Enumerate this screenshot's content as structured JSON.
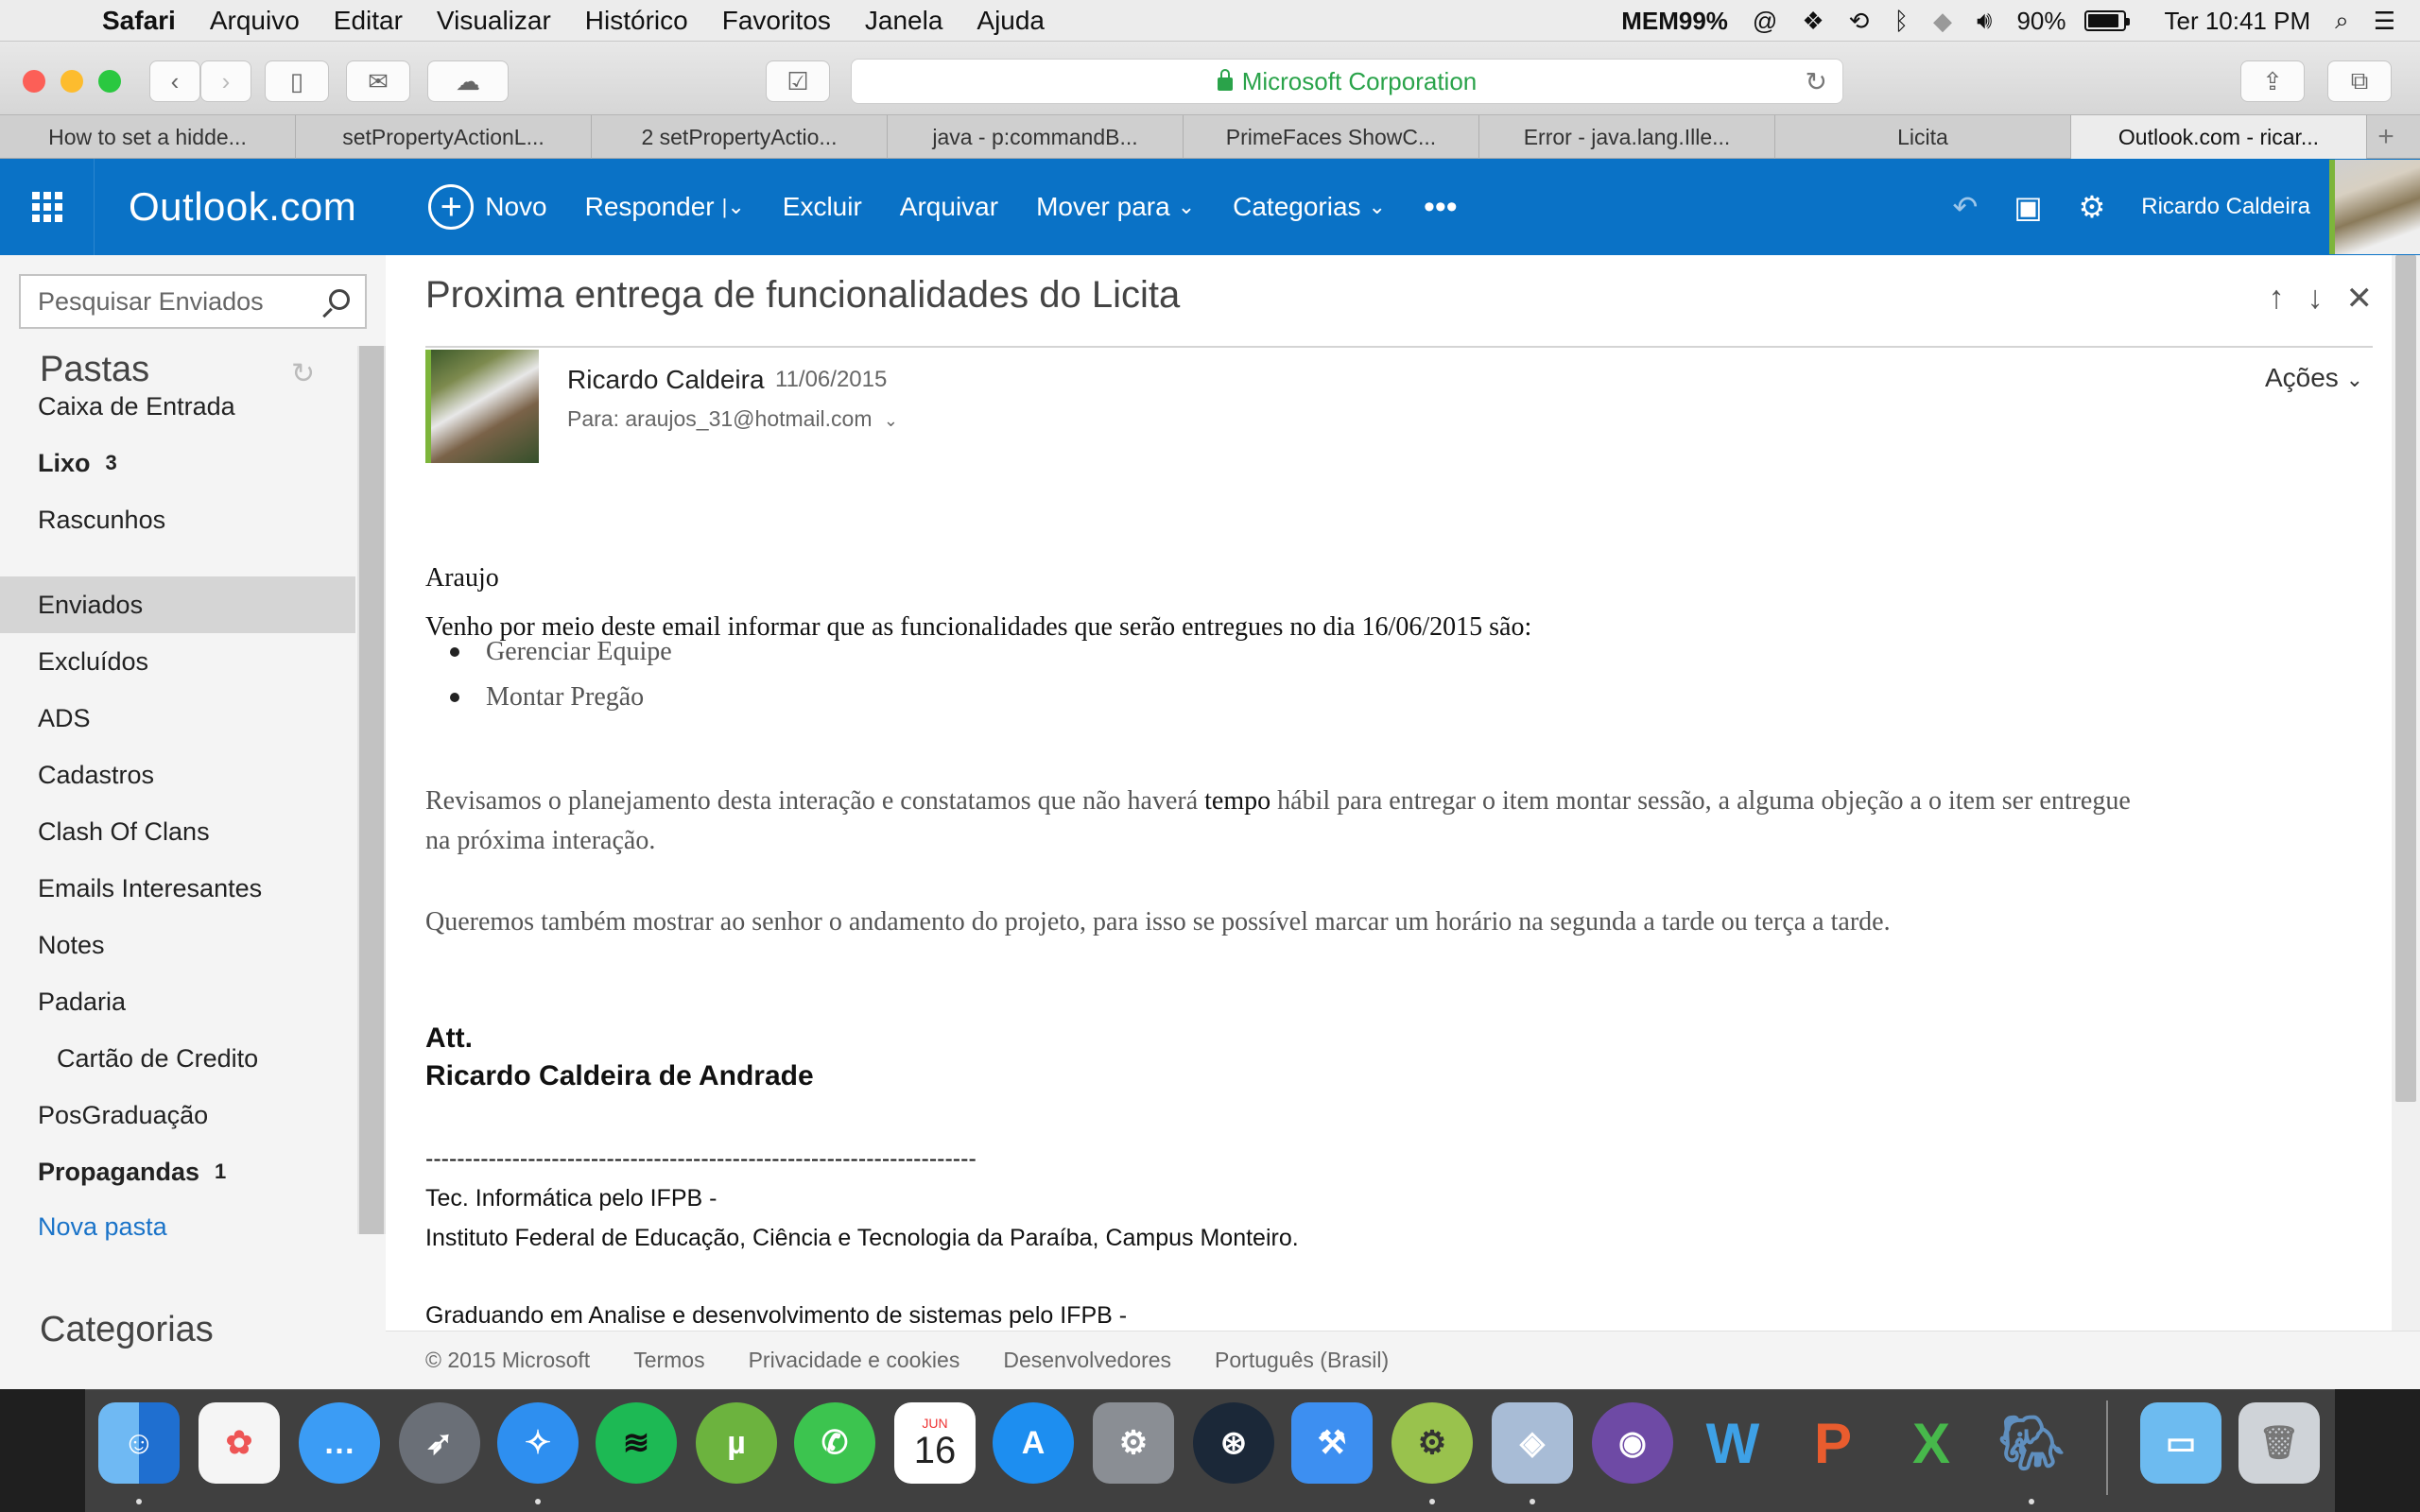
{
  "menubar": {
    "app": "Safari",
    "items": [
      "Arquivo",
      "Editar",
      "Visualizar",
      "Histórico",
      "Favoritos",
      "Janela",
      "Ajuda"
    ],
    "mem_label": "MEM",
    "mem_value": "99%",
    "battery": "90%",
    "battery_level": 0.9,
    "clock": "Ter 10:41 PM"
  },
  "browser": {
    "url_site": "Microsoft Corporation",
    "tabs": [
      {
        "label": "How to set a hidde..."
      },
      {
        "label": "setPropertyActionL..."
      },
      {
        "label": "2 setPropertyActio..."
      },
      {
        "label": "java - p:commandB..."
      },
      {
        "label": "PrimeFaces ShowC..."
      },
      {
        "label": "Error - java.lang.Ille..."
      },
      {
        "label": "Licita"
      },
      {
        "label": "Outlook.com - ricar..."
      }
    ],
    "active_tab": 7
  },
  "outlook": {
    "brand": "Outlook.com",
    "commands": {
      "new": "Novo",
      "reply": "Responder",
      "delete": "Excluir",
      "archive": "Arquivar",
      "move": "Mover para",
      "categories": "Categorias"
    },
    "user": "Ricardo Caldeira"
  },
  "nav": {
    "search_placeholder": "Pesquisar Enviados",
    "folders_heading": "Pastas",
    "folders": [
      {
        "label": "Caixa de Entrada",
        "count": ""
      },
      {
        "label": "Lixo",
        "count": "3"
      },
      {
        "label": "Rascunhos",
        "count": ""
      },
      {
        "label": "Enviados",
        "count": ""
      },
      {
        "label": "Excluídos",
        "count": ""
      },
      {
        "label": "ADS",
        "count": ""
      },
      {
        "label": "Cadastros",
        "count": ""
      },
      {
        "label": "Clash Of Clans",
        "count": ""
      },
      {
        "label": "Emails Interesantes",
        "count": ""
      },
      {
        "label": "Notes",
        "count": ""
      },
      {
        "label": "Padaria",
        "count": ""
      },
      {
        "label": "Cartão de Credito",
        "count": ""
      },
      {
        "label": "PosGraduação",
        "count": ""
      },
      {
        "label": "Propagandas",
        "count": "1"
      }
    ],
    "new_folder": "Nova pasta",
    "categories_heading": "Categorias"
  },
  "message": {
    "subject": "Proxima entrega de funcionalidades do Licita",
    "from": "Ricardo Caldeira",
    "date": "11/06/2015",
    "to": "Para: araujos_31@hotmail.com",
    "actions": "Ações",
    "greeting": "Araujo",
    "intro": "Venho por meio deste email informar que as funcionalidades que serão entregues no dia 16/06/2015 são:",
    "items": [
      "Gerenciar Equipe",
      "Montar Pregão"
    ],
    "para1_a": "Revisamos o planejamento desta interação e constatamos que não haverá ",
    "para1_b": "tempo",
    "para1_c": " hábil para entregar o item montar sessão, a alguma objeção a o item ser entregue",
    "para1_line2": "na próxima interação.",
    "para2": "Queremos também mostrar ao senhor o andamento do projeto, para isso se possível marcar um horário na segunda a tarde ou terça a tarde.",
    "sig_att": "Att.",
    "sig_name": "Ricardo Caldeira de Andrade",
    "sig_rule": "----------------------------------------------------------------------",
    "sig_line1": "Tec. Informática pelo IFPB -",
    "sig_line2": "Instituto Federal de Educação, Ciência e Tecnologia da Paraíba, Campus Monteiro.",
    "sig_line3": "Graduando em Analise e desenvolvimento de sistemas pelo IFPB -"
  },
  "footer": {
    "copyright": "© 2015 Microsoft",
    "terms": "Termos",
    "privacy": "Privacidade e cookies",
    "developers": "Desenvolvedores",
    "language": "Português (Brasil)"
  },
  "dock": {
    "calendar_month": "JUN",
    "calendar_day": "16"
  }
}
